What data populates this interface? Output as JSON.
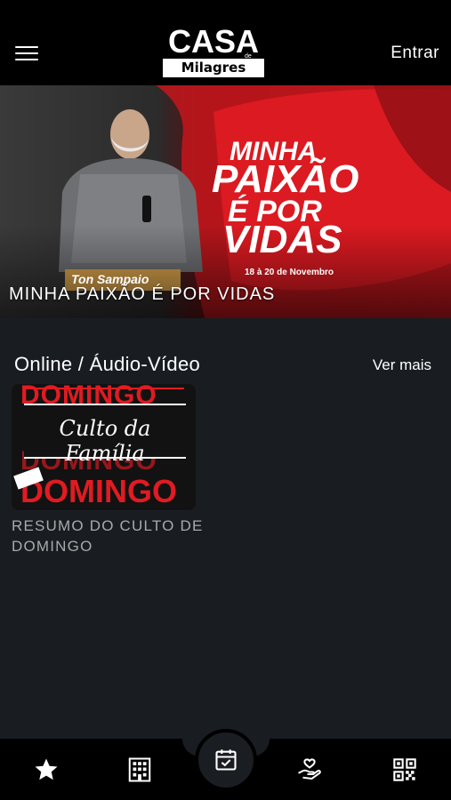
{
  "header": {
    "logo_top": "CASA",
    "logo_de": "de",
    "logo_bottom": "Milagres",
    "login_label": "Entrar"
  },
  "hero": {
    "title": "MINHA PAIXÃO É POR VIDAS",
    "banner_line1": "MINHA",
    "banner_line2": "PAIXÃO",
    "banner_line3": "É POR",
    "banner_line4": "VIDAS",
    "banner_date": "18 à 20 de Novembro",
    "banner_speaker": "Ton Sampaio"
  },
  "section": {
    "title": "Online / Áudio-Vídeo",
    "see_more": "Ver mais"
  },
  "card": {
    "thumb_word": "DOMINGO",
    "thumb_script": "Culto da Família",
    "caption": "RESUMO DO CULTO DE DOMINGO"
  },
  "nav": {
    "items": [
      "star-icon",
      "building-icon",
      "calendar-check-icon",
      "hand-heart-icon",
      "qr-code-icon"
    ]
  },
  "colors": {
    "background": "#191d22",
    "header": "#000000",
    "accent_red": "#e01b22",
    "caption_gray": "#a9a9a9"
  }
}
